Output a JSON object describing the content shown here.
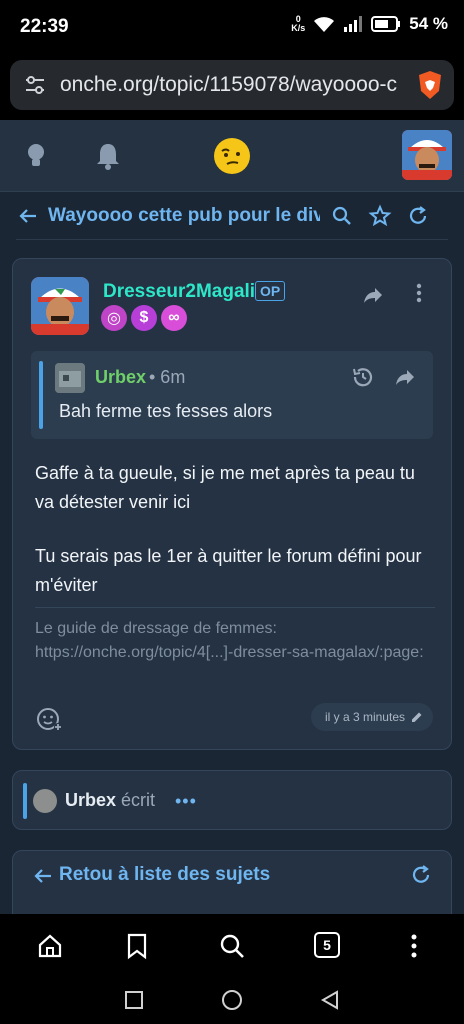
{
  "status_bar": {
    "time": "22:39",
    "net_speed_top": "0",
    "net_speed_unit": "K/s",
    "battery": "54 %"
  },
  "browser": {
    "url": "onche.org/topic/1159078/wayoooo-c"
  },
  "topic": {
    "title": "Wayoooo cette pub pour le divorce"
  },
  "post": {
    "author": "Dresseur2Magali",
    "op_badge": "OP",
    "quote": {
      "author": "Urbex",
      "time": "• 6m",
      "text": "Bah ferme tes fesses alors"
    },
    "message": [
      "Gaffe à ta gueule, si je me met après ta peau tu va détester venir ici",
      "Tu serais pas le 1er à quitter le forum défini pour m'éviter"
    ],
    "signature": "Le guide de dressage de femmes: https://onche.org/topic/4[...]-dresser-sa-magalax/:page:",
    "timestamp": "il y a 3 minutes"
  },
  "typing": {
    "user": "Urbex",
    "verb": "écrit",
    "dots": "•••"
  },
  "back": {
    "label": "Retou à liste des sujets"
  },
  "toolbar": {
    "tabs_count": "5"
  },
  "colors": {
    "accent": "#6fb6f0",
    "author": "#2ee6c8",
    "quote_author": "#6fd06a",
    "background": "#1b2634",
    "card": "#243243"
  }
}
